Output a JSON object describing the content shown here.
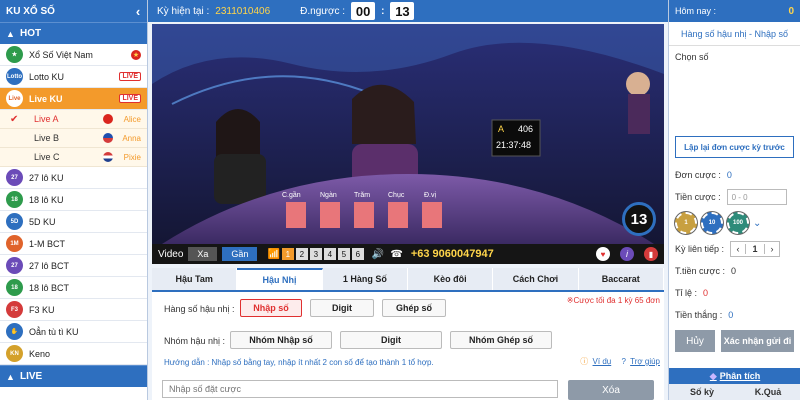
{
  "sidebar": {
    "title": "KU XỔ SỐ",
    "hot_group": "HOT",
    "items": [
      {
        "label": "Xổ Số Việt Nam",
        "icon_text": "",
        "color": "#2e9b4c"
      },
      {
        "label": "Lotto KU",
        "icon_text": "Lotto",
        "color": "#2e6fbf",
        "badge": "LIVE"
      },
      {
        "label": "Live KU",
        "icon_text": "Live",
        "color": "#e0632b",
        "badge": "LIVE"
      }
    ],
    "live_rooms": [
      {
        "label": "Live A",
        "dealer": "Alice",
        "flag_color": "#da251d"
      },
      {
        "label": "Live B",
        "dealer": "Anna",
        "flag_color": "#1f4fae"
      },
      {
        "label": "Live C",
        "dealer": "Pixie",
        "flag_color": "#d43b3b"
      }
    ],
    "games": [
      {
        "label": "27 lô KU",
        "icon_text": "27",
        "color": "#6b4bb8"
      },
      {
        "label": "18 lô KU",
        "icon_text": "18",
        "color": "#2e9b4c"
      },
      {
        "label": "5D KU",
        "icon_text": "5D",
        "color": "#2e6fbf"
      },
      {
        "label": "1-M BCT",
        "icon_text": "1M",
        "color": "#e0632b"
      },
      {
        "label": "27 lô BCT",
        "icon_text": "27",
        "color": "#6b4bb8"
      },
      {
        "label": "18 lô BCT",
        "icon_text": "18",
        "color": "#2e9b4c"
      },
      {
        "label": "F3 KU",
        "icon_text": "F3",
        "color": "#d43b3b"
      },
      {
        "label": "Oẳn tù tì KU",
        "icon_text": "✋",
        "color": "#2e6fbf"
      },
      {
        "label": "Keno",
        "icon_text": "KN",
        "color": "#d4a12b"
      }
    ],
    "live_group": "LIVE"
  },
  "topbar": {
    "period_label": "Kỳ hiện tại :",
    "period_value": "2311010406",
    "countdown_label": "Đ.ngược :",
    "minutes": "00",
    "seconds": "13"
  },
  "video": {
    "label": "Video",
    "btn_far": "Xa",
    "btn_near": "Gần",
    "channels": [
      "1",
      "2",
      "3",
      "4",
      "5",
      "6"
    ],
    "hotline": "+63 9060047947",
    "counter": "13",
    "screen_a": "A",
    "screen_count": "406",
    "screen_time": "21:37:48",
    "table_labels": [
      "C.gần",
      "Ngàn",
      "Trăm",
      "Chục",
      "Đ.vị"
    ]
  },
  "tabs": [
    "Hậu Tam",
    "Hậu Nhị",
    "1 Hàng Số",
    "Kèo đôi",
    "Cách Chơi",
    "Baccarat"
  ],
  "bet": {
    "row1_label": "Hàng số hậu nhị :",
    "row1_opts": [
      "Nhập số",
      "Digit",
      "Ghép số"
    ],
    "note": "※Cược tối đa 1 kỳ 65 đơn",
    "row2_label": "Nhóm hậu nhị :",
    "row2_opts": [
      "Nhóm Nhập số",
      "Digit",
      "Nhóm Ghép số"
    ],
    "hint": "Hướng dẫn : Nhập số bằng tay, nhập ít nhất 2 con số để tạo thành 1 tổ hợp.",
    "example": "Ví dụ",
    "help": "Trợ giúp",
    "input_placeholder": "Nhập số đặt cược",
    "clear": "Xóa"
  },
  "right": {
    "today_label": "Hôm nay :",
    "today_value": "0",
    "title": "Hàng số hậu nhị - Nhập số",
    "chon": "Chọn số",
    "redo": "Lập lại đơn cược kỳ trước",
    "don_cuoc_label": "Đơn cược :",
    "don_cuoc_value": "0",
    "tien_cuoc_label": "Tiền cược :",
    "tien_cuoc_placeholder": "0 - 0",
    "chips": [
      "1",
      "10",
      "100"
    ],
    "ky_lien_tiep_label": "Kỳ liên tiếp :",
    "ky_lien_tiep_value": "1",
    "t_tien_cuoc_label": "T.tiền cược :",
    "t_tien_cuoc_value": "0",
    "ti_le_label": "Tỉ lệ :",
    "ti_le_value": "0",
    "tien_thang_label": "Tiền thắng :",
    "tien_thang_value": "0",
    "cancel": "Hủy",
    "submit": "Xác nhận gửi đi",
    "analysis": "Phân tích",
    "col_ky": "Số kỳ",
    "col_kq": "K.Quả"
  }
}
